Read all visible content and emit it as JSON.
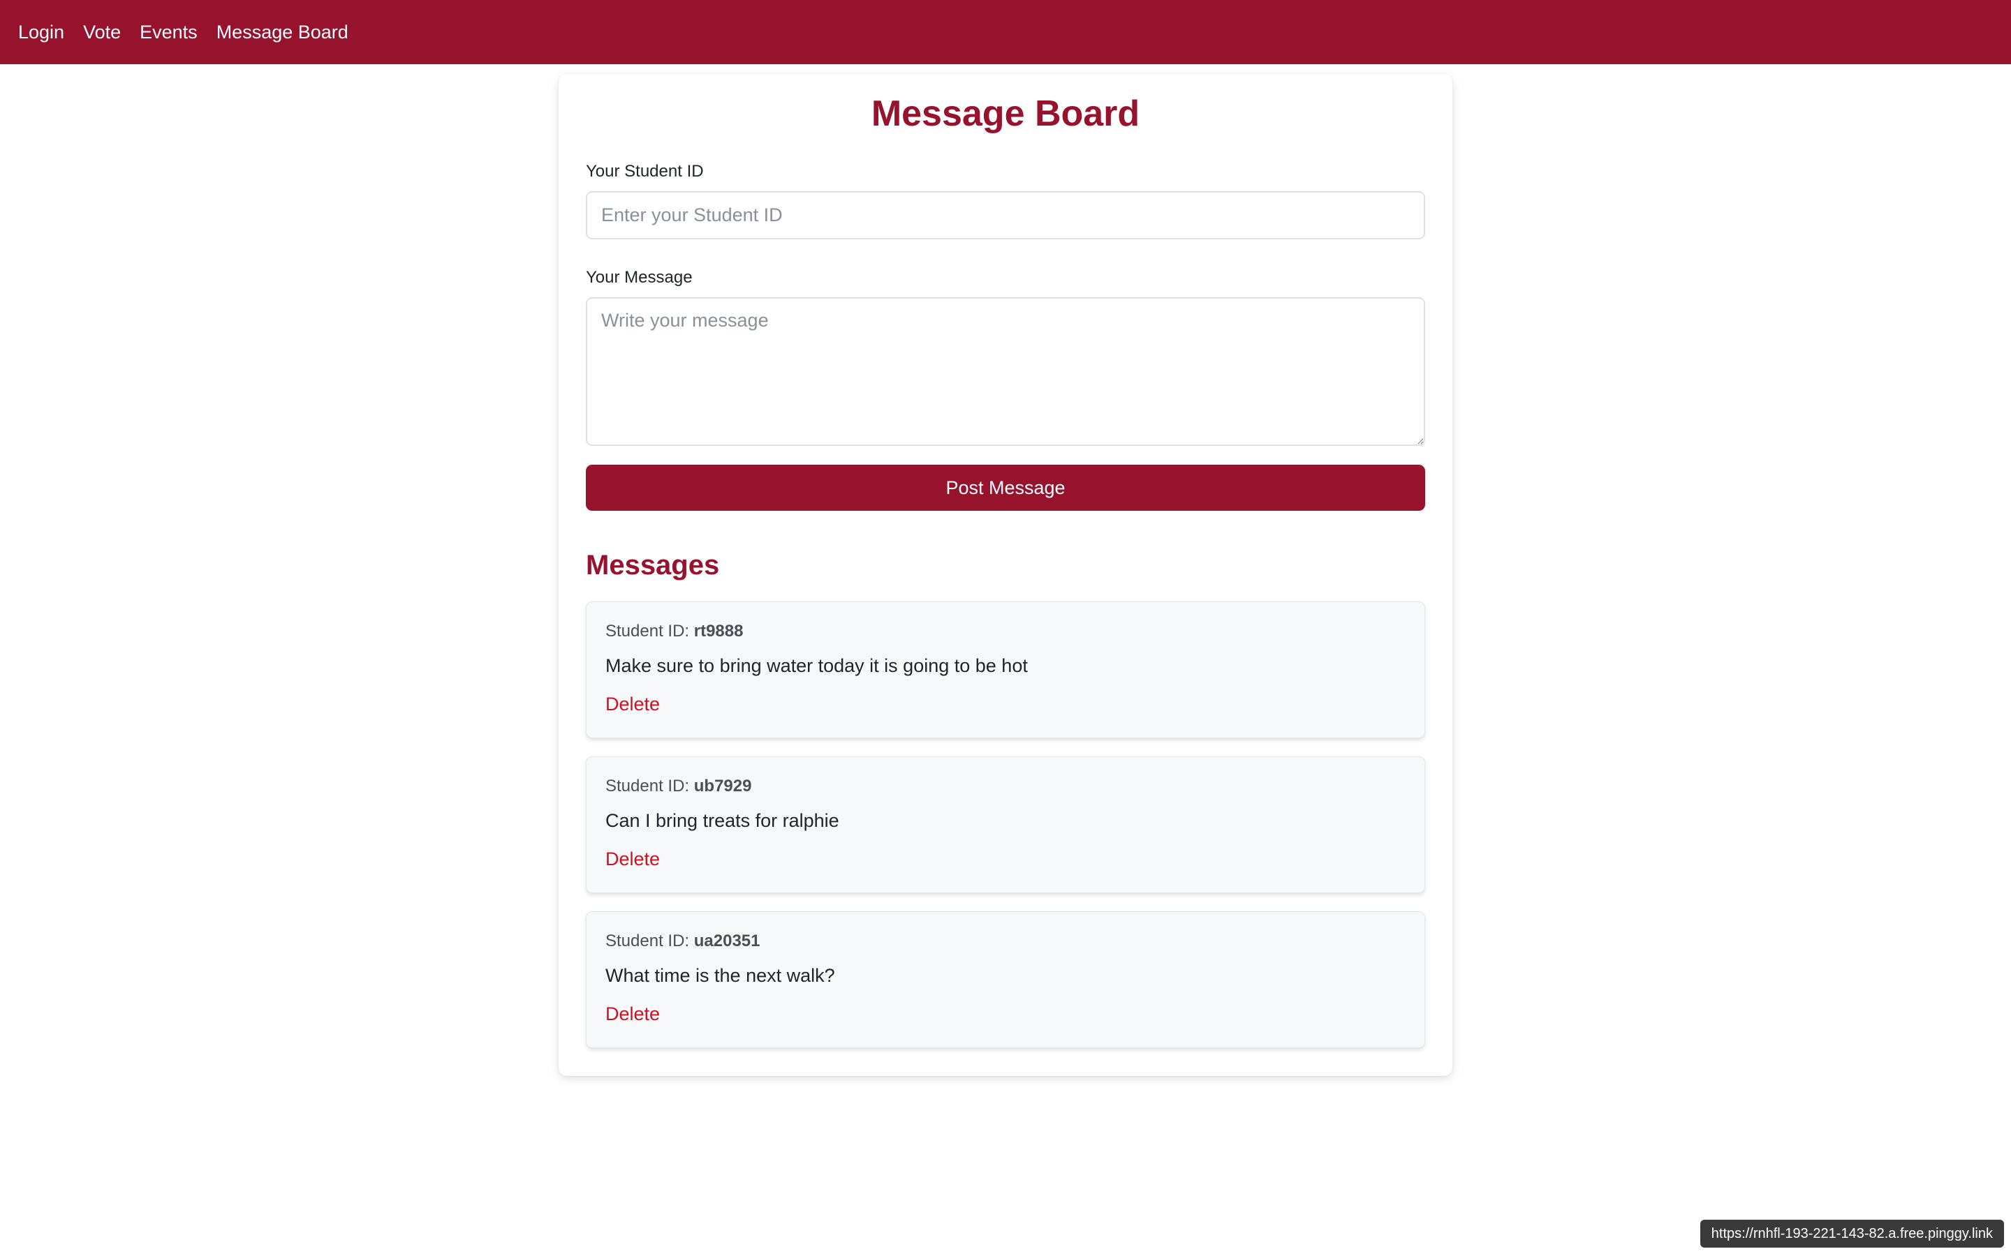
{
  "colors": {
    "brand": "#97122c",
    "danger": "#cc1122"
  },
  "nav": {
    "items": [
      {
        "label": "Login"
      },
      {
        "label": "Vote"
      },
      {
        "label": "Events"
      },
      {
        "label": "Message Board"
      }
    ]
  },
  "page": {
    "title": "Message Board"
  },
  "form": {
    "student_id_label": "Your Student ID",
    "student_id_placeholder": "Enter your Student ID",
    "student_id_value": "",
    "message_label": "Your Message",
    "message_placeholder": "Write your message",
    "message_value": "",
    "submit_label": "Post Message"
  },
  "messages": {
    "heading": "Messages",
    "id_prefix": "Student ID:",
    "delete_label": "Delete",
    "items": [
      {
        "student_id": "rt9888",
        "text": "Make sure to bring water today it is going to be hot"
      },
      {
        "student_id": "ub7929",
        "text": "Can I bring treats for ralphie"
      },
      {
        "student_id": "ua20351",
        "text": "What time is the next walk?"
      }
    ]
  },
  "status_bar": {
    "url": "https://rnhfl-193-221-143-82.a.free.pinggy.link"
  }
}
